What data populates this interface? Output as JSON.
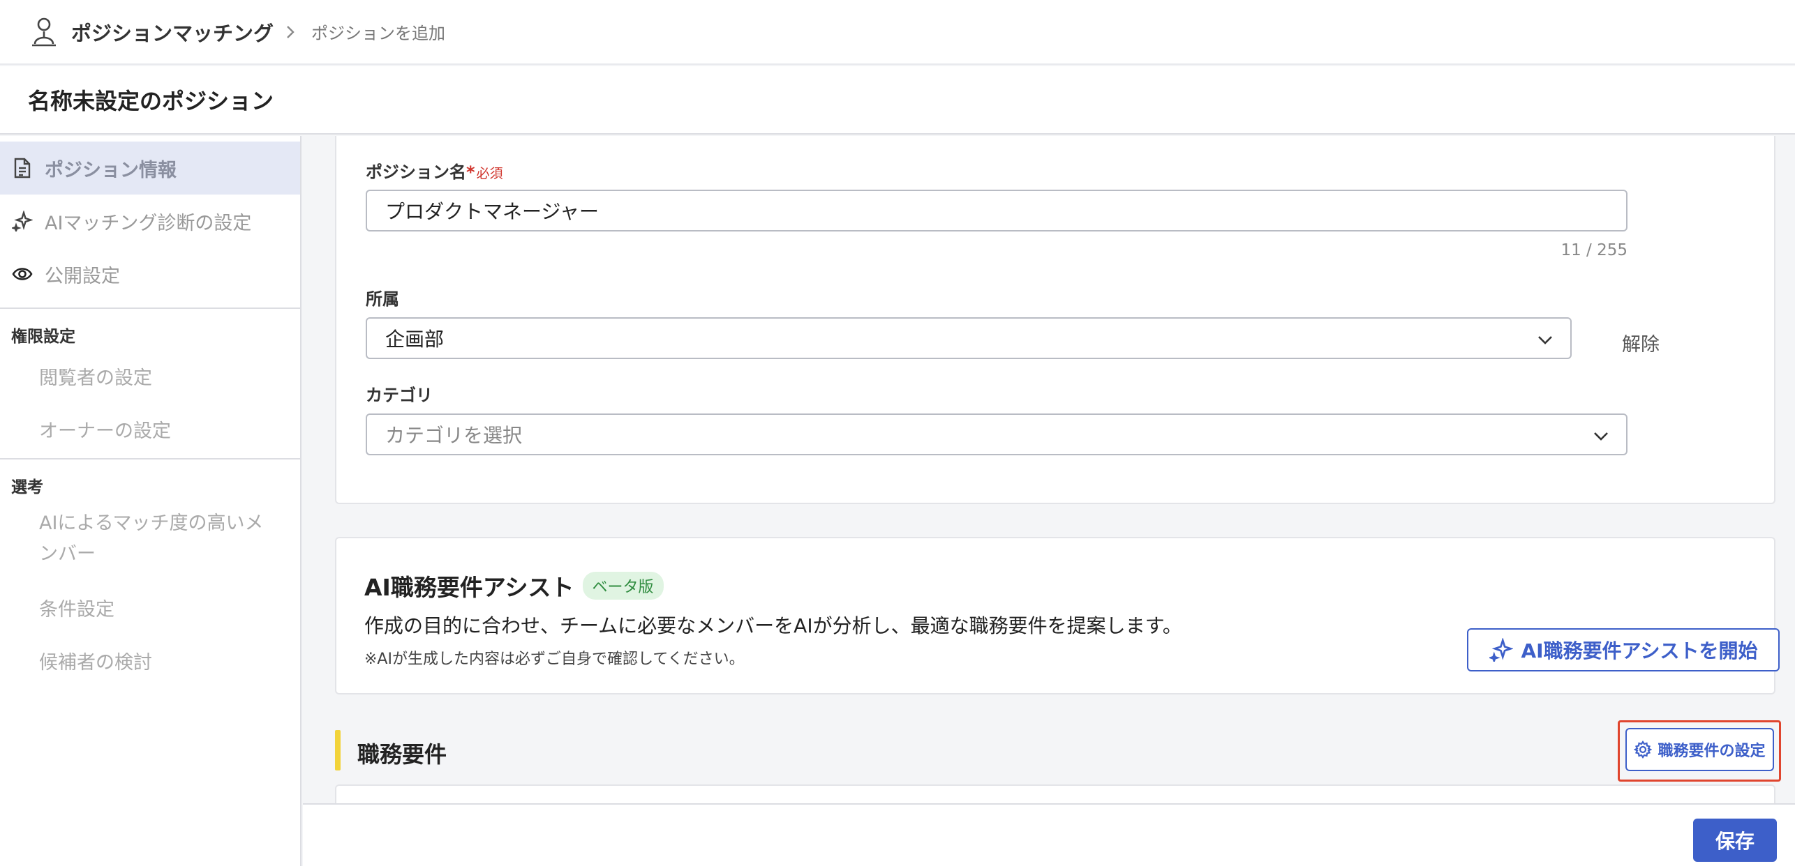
{
  "header": {
    "app_title": "ポジションマッチング",
    "breadcrumb": "ポジションを追加",
    "page_title": "名称未設定のポジション"
  },
  "sidebar": {
    "items": [
      {
        "label": "ポジション情報",
        "icon": "document-icon",
        "active": true
      },
      {
        "label": "AIマッチング診断の設定",
        "icon": "sparkle-icon",
        "active": false
      },
      {
        "label": "公開設定",
        "icon": "eye-icon",
        "active": false
      }
    ],
    "sections": [
      {
        "title": "権限設定",
        "items": [
          "閲覧者の設定",
          "オーナーの設定"
        ]
      },
      {
        "title": "選考",
        "items": [
          "AIによるマッチ度の高いメンバー",
          "条件設定",
          "候補者の検討"
        ]
      }
    ]
  },
  "form": {
    "position_name": {
      "label": "ポジション名",
      "required_mark": "*",
      "required_text": "必須",
      "value": "プロダクトマネージャー",
      "counter": "11 / 255"
    },
    "affiliation": {
      "label": "所属",
      "value": "企画部",
      "clear_label": "解除"
    },
    "category": {
      "label": "カテゴリ",
      "placeholder": "カテゴリを選択"
    }
  },
  "assist": {
    "title": "AI職務要件アシスト",
    "badge": "ベータ版",
    "description": "作成の目的に合わせ、チームに必要なメンバーをAIが分析し、最適な職務要件を提案します。",
    "note": "※AIが生成した内容は必ずご自身で確認してください。",
    "button_label": "AI職務要件アシストを開始"
  },
  "requirements": {
    "title": "職務要件",
    "settings_button": "職務要件の設定"
  },
  "footer": {
    "save_label": "保存"
  },
  "colors": {
    "accent": "#3d5fc9",
    "required": "#d0342c",
    "section_bar": "#f2d33a",
    "highlight_border": "#e0452e",
    "beta_bg": "#e0f4e2",
    "beta_text": "#2f8c3f"
  }
}
